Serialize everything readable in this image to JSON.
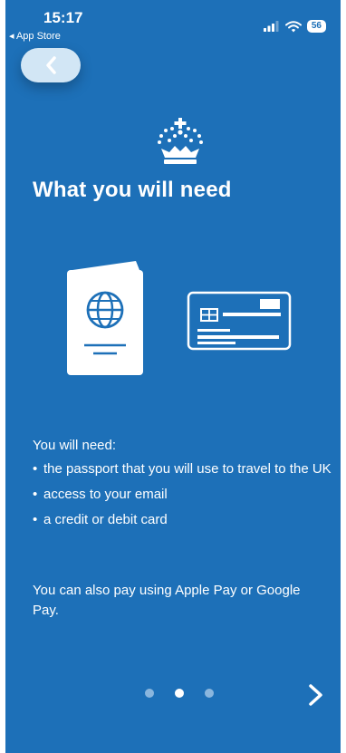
{
  "status_bar": {
    "time": "15:17",
    "back_app": "◂ App Store",
    "battery": "56"
  },
  "header": {
    "back_icon": "chevron-left-icon",
    "crest_icon": "crown-icon"
  },
  "page": {
    "title": "What you will need",
    "intro": "You will need:",
    "items": [
      "the passport that you will use to travel to the UK",
      "access to your email",
      "a credit or debit card"
    ],
    "note": "You can also pay using Apple Pay or Google Pay."
  },
  "illustration": {
    "left_icon": "passport-icon",
    "right_icon": "credit-card-icon"
  },
  "pager": {
    "total": 3,
    "current": 2,
    "next_icon": "chevron-right-icon"
  },
  "colors": {
    "background": "#1d70b8",
    "back_button": "#d2e6f5",
    "dot_inactive": "#8ab6de",
    "foreground": "#ffffff"
  }
}
